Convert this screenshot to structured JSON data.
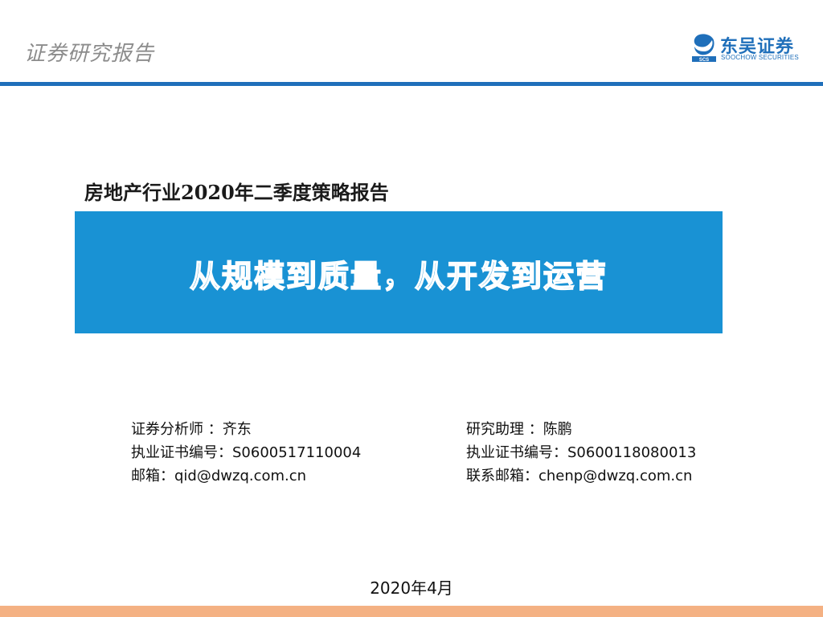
{
  "header": {
    "label": "证券研究报告",
    "logo": {
      "icon": "soochow-securities-logo-mark",
      "name_cn": "东吴证券",
      "name_en": "SOOCHOW SECURITIES",
      "brand_color": "#1f6fba"
    }
  },
  "report": {
    "subtitle": "房地产行业2020年二季度策略报告",
    "title": "从规模到质量，从开发到运营",
    "banner_color": "#1992d4"
  },
  "analyst": {
    "role_line": "证券分析师 ：齐东",
    "license_line": "执业证书编号：S0600517110004",
    "email_line": "邮箱：qid@dwzq.com.cn"
  },
  "assistant": {
    "role_line": "研究助理 ：陈鹏",
    "license_line": "执业证书编号：S0600118080013",
    "email_line": "联系邮箱：chenp@dwzq.com.cn"
  },
  "date": "2020年4月",
  "footer": {
    "bar_color": "#f4b183"
  }
}
